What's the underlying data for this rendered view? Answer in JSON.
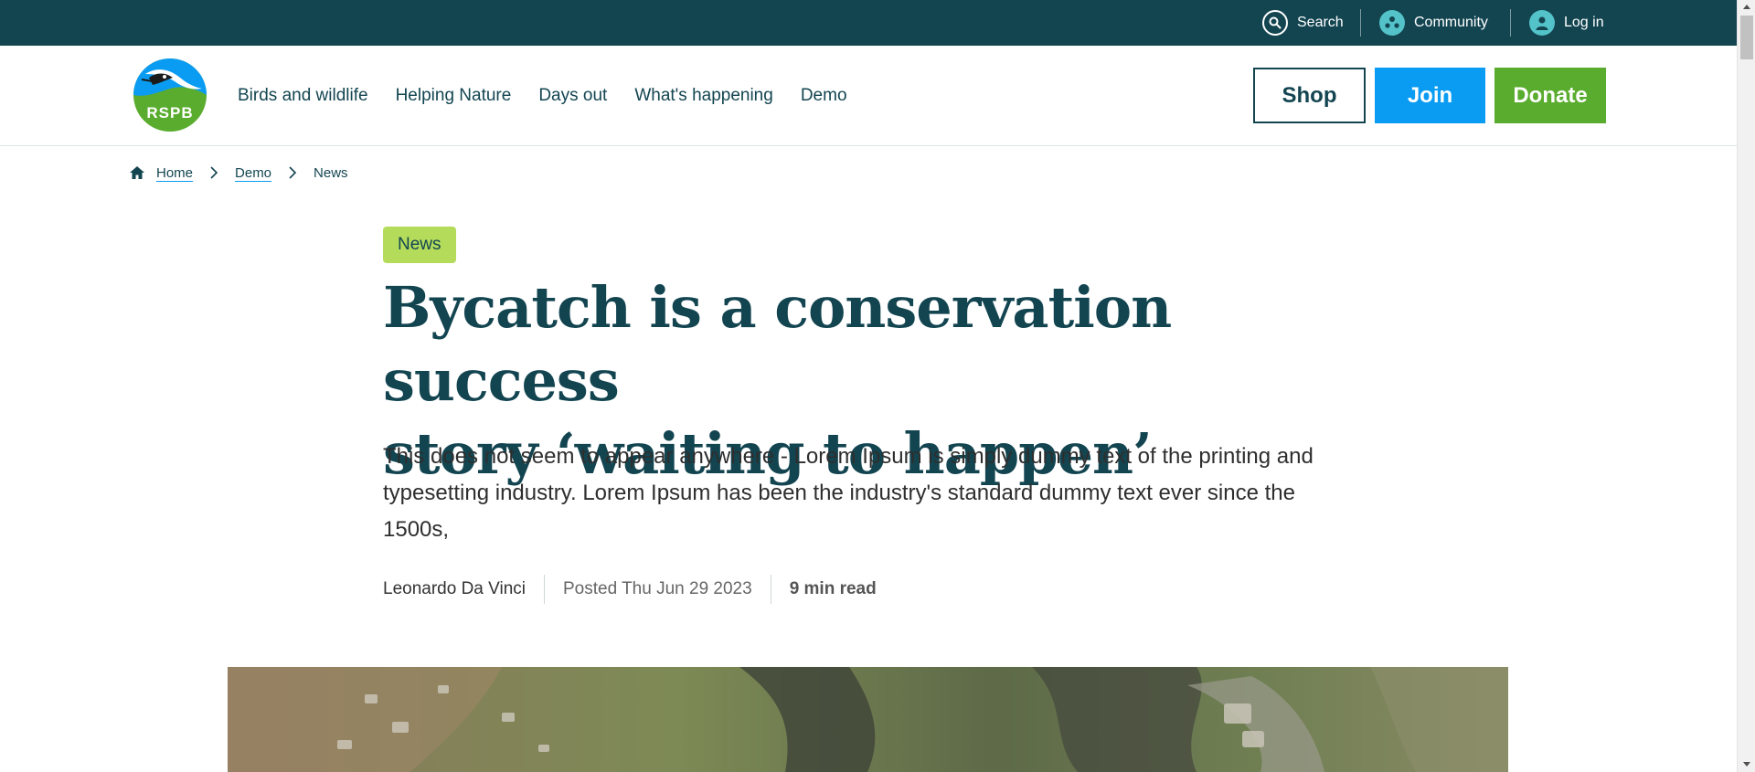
{
  "utility": {
    "search_label": "Search",
    "community_label": "Community",
    "login_label": "Log in"
  },
  "header": {
    "logo_text": "RSPB",
    "nav": [
      "Birds and wildlife",
      "Helping Nature",
      "Days out",
      "What's happening",
      "Demo"
    ],
    "shop_label": "Shop",
    "join_label": "Join",
    "donate_label": "Donate"
  },
  "breadcrumb": {
    "home": "Home",
    "demo": "Demo",
    "current": "News"
  },
  "article": {
    "tag": "News",
    "title_line1": "Bycatch is a conservation success",
    "title_line2": "story ‘waiting to happen’",
    "intro": "This does not seem to appear anywhere - Lorem Ipsum is simply dummy text of the printing and typesetting industry. Lorem Ipsum has been the industry's standard dummy text ever since the 1500s,",
    "author": "Leonardo Da Vinci",
    "posted": "Posted Thu Jun 29 2023",
    "read_time": "9 min read"
  },
  "colors": {
    "utility_bg": "#134551",
    "brand_teal": "#134551",
    "join_blue": "#0a9cf2",
    "donate_green": "#5aac2e",
    "tag_lime": "#b4dc5a",
    "icon_aqua": "#53c2c9"
  }
}
